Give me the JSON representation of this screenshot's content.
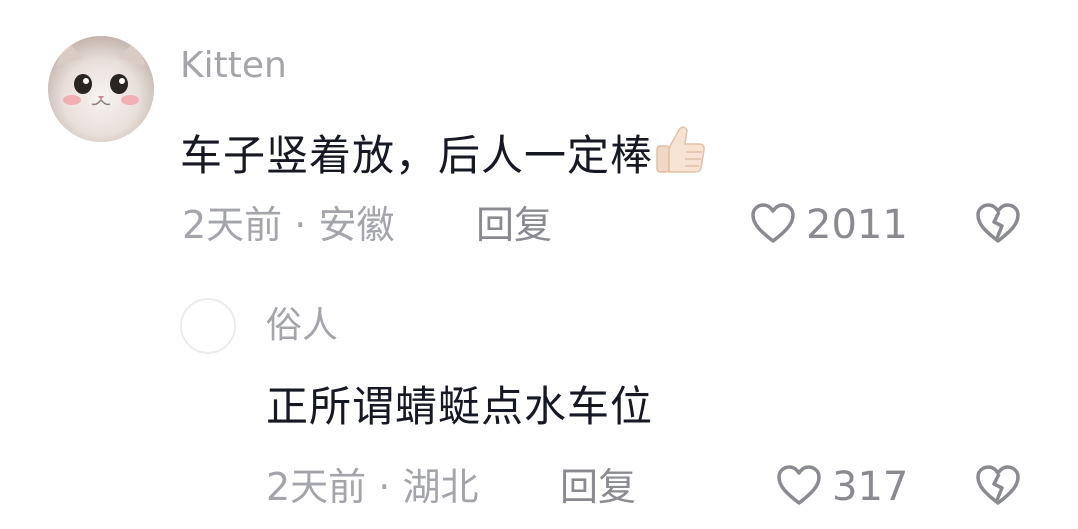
{
  "comments": [
    {
      "username": "Kitten",
      "text": "车子竖着放，后人一定棒",
      "emoji": "thumbs-up",
      "time": "2天前",
      "separator": "·",
      "location": "安徽",
      "reply_label": "回复",
      "likes": "2011"
    },
    {
      "username": "俗人",
      "text": "正所谓蜻蜓点水车位",
      "time": "2天前",
      "separator": "·",
      "location": "湖北",
      "reply_label": "回复",
      "likes": "317"
    }
  ],
  "icons": {
    "like": "heart-outline-icon",
    "dislike": "broken-heart-icon"
  },
  "colors": {
    "text": "#161823",
    "secondary": "#a3a5ab",
    "action": "#8a8b91"
  }
}
